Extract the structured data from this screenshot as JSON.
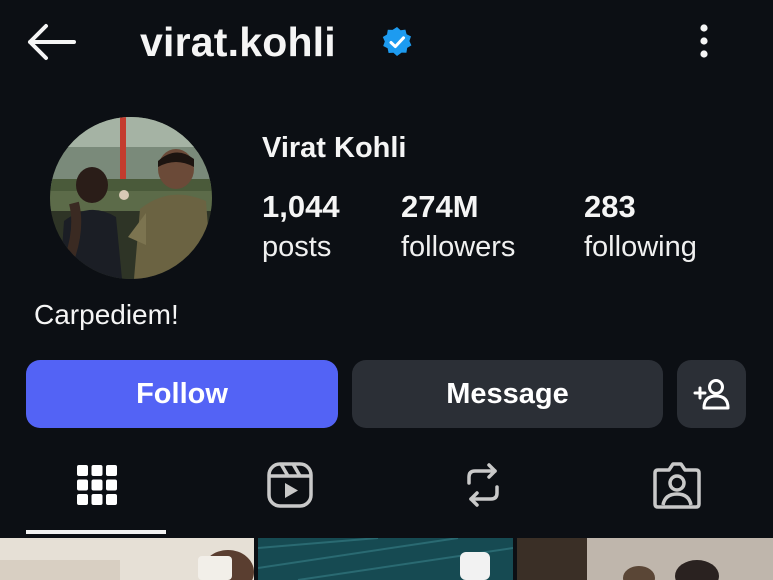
{
  "header": {
    "username": "virat.kohli",
    "back_icon": "arrow-left-icon",
    "verified_icon": "verified-badge-icon",
    "menu_icon": "more-vertical-icon"
  },
  "profile": {
    "full_name": "Virat Kohli",
    "bio": "Carpediem!",
    "stats": {
      "posts": {
        "count": "1,044",
        "label": "posts"
      },
      "followers": {
        "count": "274M",
        "label": "followers"
      },
      "following": {
        "count": "283",
        "label": "following"
      }
    }
  },
  "actions": {
    "follow_label": "Follow",
    "message_label": "Message",
    "add_person_icon": "add-person-icon"
  },
  "tabs": [
    {
      "icon": "grid-icon",
      "active": true
    },
    {
      "icon": "reels-icon",
      "active": false
    },
    {
      "icon": "repost-icon",
      "active": false
    },
    {
      "icon": "tagged-icon",
      "active": false
    }
  ],
  "colors": {
    "background": "#0c0f14",
    "follow_button": "#5363f5",
    "secondary_button": "#2b2f36",
    "verified_badge": "#1d9bf0"
  }
}
